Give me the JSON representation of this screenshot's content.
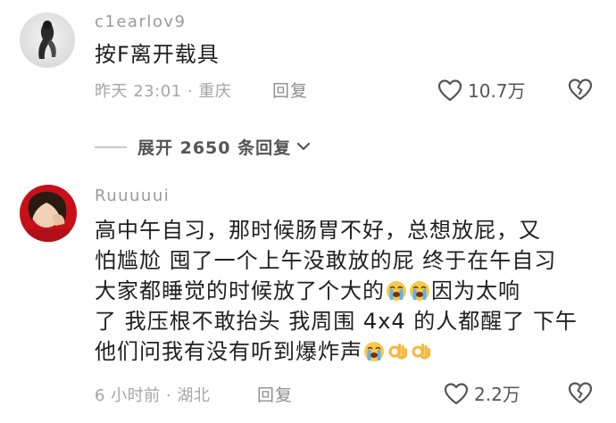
{
  "comment1": {
    "username": "c1earlov9",
    "text": "按F离开载具",
    "time": "昨天 23:01",
    "location": "重庆",
    "reply_label": "回复",
    "like_count": "10.7万"
  },
  "expand": {
    "label": "展开 2650 条回复"
  },
  "comment2": {
    "username": "Ruuuuui",
    "lines": [
      "高中午自习，那时候肠胃不好，总想放屁，又",
      "怕尴尬 囤了一个上午没敢放的屁 终于在午自习",
      "大家都睡觉的时候放了个大的",
      "因为太响",
      "了 我压根不敢抬头 我周围 4x4 的人都醒了 下午",
      "他们问我有没有听到爆炸声"
    ],
    "time": "6 小时前",
    "location": "湖北",
    "reply_label": "回复",
    "like_count": "2.2万"
  },
  "colors": {
    "text": "#1f1f1f",
    "meta": "#a6a6a6",
    "accent_emoji": "#f5b83d"
  },
  "icons": {
    "like": "heart-outline-icon",
    "dislike": "broken-heart-icon",
    "expand": "chevron-down-icon",
    "crying_emoji": "loudly-crying-face-icon",
    "ok_emoji": "ok-hand-icon"
  }
}
